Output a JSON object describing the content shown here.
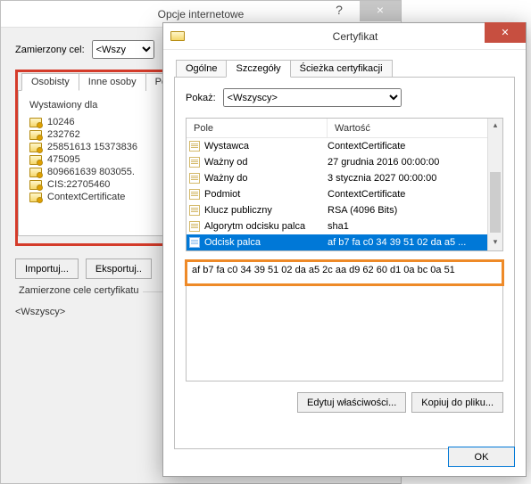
{
  "back": {
    "title": "Opcje internetowe",
    "purpose_label": "Zamierzony cel:",
    "purpose_value_visible": "<Wszy",
    "tabs": [
      "Osobisty",
      "Inne osoby",
      "Poś"
    ],
    "col_header": "Wystawiony dla",
    "certs": [
      "10246",
      "232762",
      "25851613 15373836",
      "475095",
      "809661639 803055.",
      "CIS:22705460",
      "ContextCertificate"
    ],
    "btn_import": "Importuj...",
    "btn_export": "Eksportuj..",
    "intended_label": "Zamierzone cele certyfikatu",
    "intended_value": "<Wszyscy>"
  },
  "front": {
    "title": "Certyfikat",
    "tabs": [
      "Ogólne",
      "Szczegóły",
      "Ścieżka certyfikacji"
    ],
    "show_label": "Pokaż:",
    "show_value": "<Wszyscy>",
    "col_field": "Pole",
    "col_value": "Wartość",
    "rows": [
      {
        "field": "Wystawca",
        "value": "ContextCertificate"
      },
      {
        "field": "Ważny od",
        "value": "27 grudnia 2016 00:00:00"
      },
      {
        "field": "Ważny do",
        "value": "3 stycznia 2027 00:00:00"
      },
      {
        "field": "Podmiot",
        "value": "ContextCertificate"
      },
      {
        "field": "Klucz publiczny",
        "value": "RSA (4096 Bits)"
      },
      {
        "field": "Algorytm odcisku palca",
        "value": "sha1"
      },
      {
        "field": "Odcisk palca",
        "value": "af b7 fa c0 34 39 51 02 da a5 ..."
      }
    ],
    "selected_row_index": 6,
    "detail_text": "af b7 fa c0 34 39 51 02 da a5 2c aa d9 62 60 d1 0a bc 0a 51",
    "btn_edit": "Edytuj właściwości...",
    "btn_copy": "Kopiuj do pliku...",
    "btn_ok": "OK"
  }
}
